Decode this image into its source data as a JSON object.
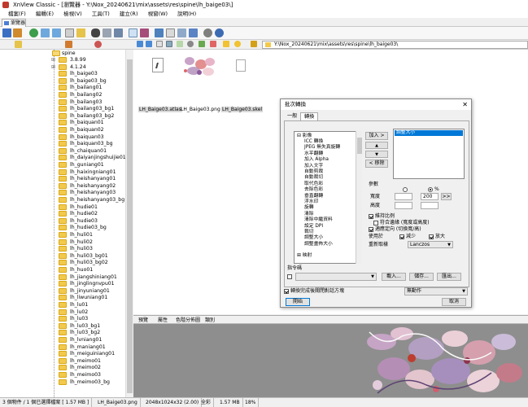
{
  "window": {
    "title": "XnView Classic - [瀏覽器 - Y:\\Nox_20240621\\mix\\assets\\res\\spine\\lh_baige03\\]"
  },
  "menu": [
    "檔案(F)",
    "編輯(E)",
    "檢視(V)",
    "工具(T)",
    "建立(R)",
    "視窗(W)",
    "說明(H)"
  ],
  "tabs": {
    "browser": "瀏覽器"
  },
  "path": {
    "value": "Y:\\Nox_20240621\\mix\\assets\\res\\spine\\lh_baige03\\"
  },
  "tree": {
    "root": "spine",
    "items": [
      "3.8.99",
      "4.1.24",
      "lh_baige03",
      "lh_baige03_bg",
      "lh_bailang01",
      "lh_bailang02",
      "lh_bailang03",
      "lh_bailang03_bg1",
      "lh_bailang03_bg2",
      "lh_baiquan01",
      "lh_baiquan02",
      "lh_baiquan03",
      "lh_baiquan03_bg",
      "lh_chaiquan01",
      "lh_daiyanjingshuijie01",
      "lh_guniang01",
      "lh_haixingniang01",
      "lh_heishanyang01",
      "lh_heishanyang02",
      "lh_heishanyang03",
      "lh_heishanyang03_bg",
      "lh_hudie01",
      "lh_hudie02",
      "lh_hudie03",
      "lh_hudie03_bg",
      "lh_huli01",
      "lh_huli02",
      "lh_huli03",
      "lh_huli03_bg01",
      "lh_huli03_bg02",
      "lh_huo01",
      "lh_jiangshiniang01",
      "lh_jinglingnvpu01",
      "lh_jinyuniang01",
      "lh_liwuniang01",
      "lh_lu01",
      "lh_lu02",
      "lh_lu03",
      "lh_lu03_bg1",
      "lh_lu03_bg2",
      "lh_lvniang01",
      "lh_maniang01",
      "lh_meiguiniang01",
      "lh_meimo01",
      "lh_meimo02",
      "lh_meimo03",
      "lh_meimo03_bg"
    ]
  },
  "files": [
    {
      "name": "LH_Baige03.atlas",
      "icon": "atlas-file-icon"
    },
    {
      "name": "LH_Baige03.png",
      "icon": "png-thumbnail"
    },
    {
      "name": "LH_Baige03.skel",
      "icon": "skel-file-icon"
    }
  ],
  "preview_tabs": [
    "預覽",
    "屬性",
    "色階分佈圖",
    "類別"
  ],
  "status": {
    "count": "3 個物件 / 1 個已選擇檔案 [ 1.57 MB ]",
    "file": "LH_Baige03.png",
    "dims": "2048x1024x32 (2.00)",
    "color": "全彩",
    "size": "1.57 MB",
    "zoom": "18%"
  },
  "dialog": {
    "title": "批次轉換",
    "tabs": [
      "一般",
      "轉換"
    ],
    "ops_root": "影像",
    "ops": [
      "ICC 轉換",
      "JPEG 無失真旋轉",
      "水平翻轉",
      "加入 Alpha",
      "加入文字",
      "自動剪裁",
      "自動裁切",
      "取代色彩",
      "去除色彩",
      "垂直翻轉",
      "浮水印",
      "旋轉",
      "清除",
      "清除中繼資料",
      "設定 DPI",
      "裁切",
      "調整大小",
      "調整畫佈大小"
    ],
    "ops_more": "映射",
    "add_button": "加入 >",
    "up_button": "▲",
    "down_button": "▼",
    "remove_button": "< 移除",
    "selected_ops": [
      "調整大小"
    ],
    "params_label": "參數",
    "width_label": "寬度",
    "height_label": "高度",
    "width_value": "200",
    "unit_pixel": "",
    "unit_percent": "%",
    "more_button": ">>",
    "keep_ratio": "維持比例",
    "fit": "符合邊緣 (寬度或高度)",
    "portrait": "適應定向 (切換寬/高)",
    "apply_label": "使用於",
    "shrink": "減少",
    "enlarge": "放大",
    "resample_label": "重新取樣",
    "resample_value": "Lanczos",
    "script_label": "指令碼",
    "load_button": "載入...",
    "save_button": "儲存...",
    "export_button": "匯出...",
    "close_on_finish": "轉換完成後關閉對話方塊",
    "action_value": "無動作",
    "start_button": "開始",
    "cancel_button": "取消"
  }
}
